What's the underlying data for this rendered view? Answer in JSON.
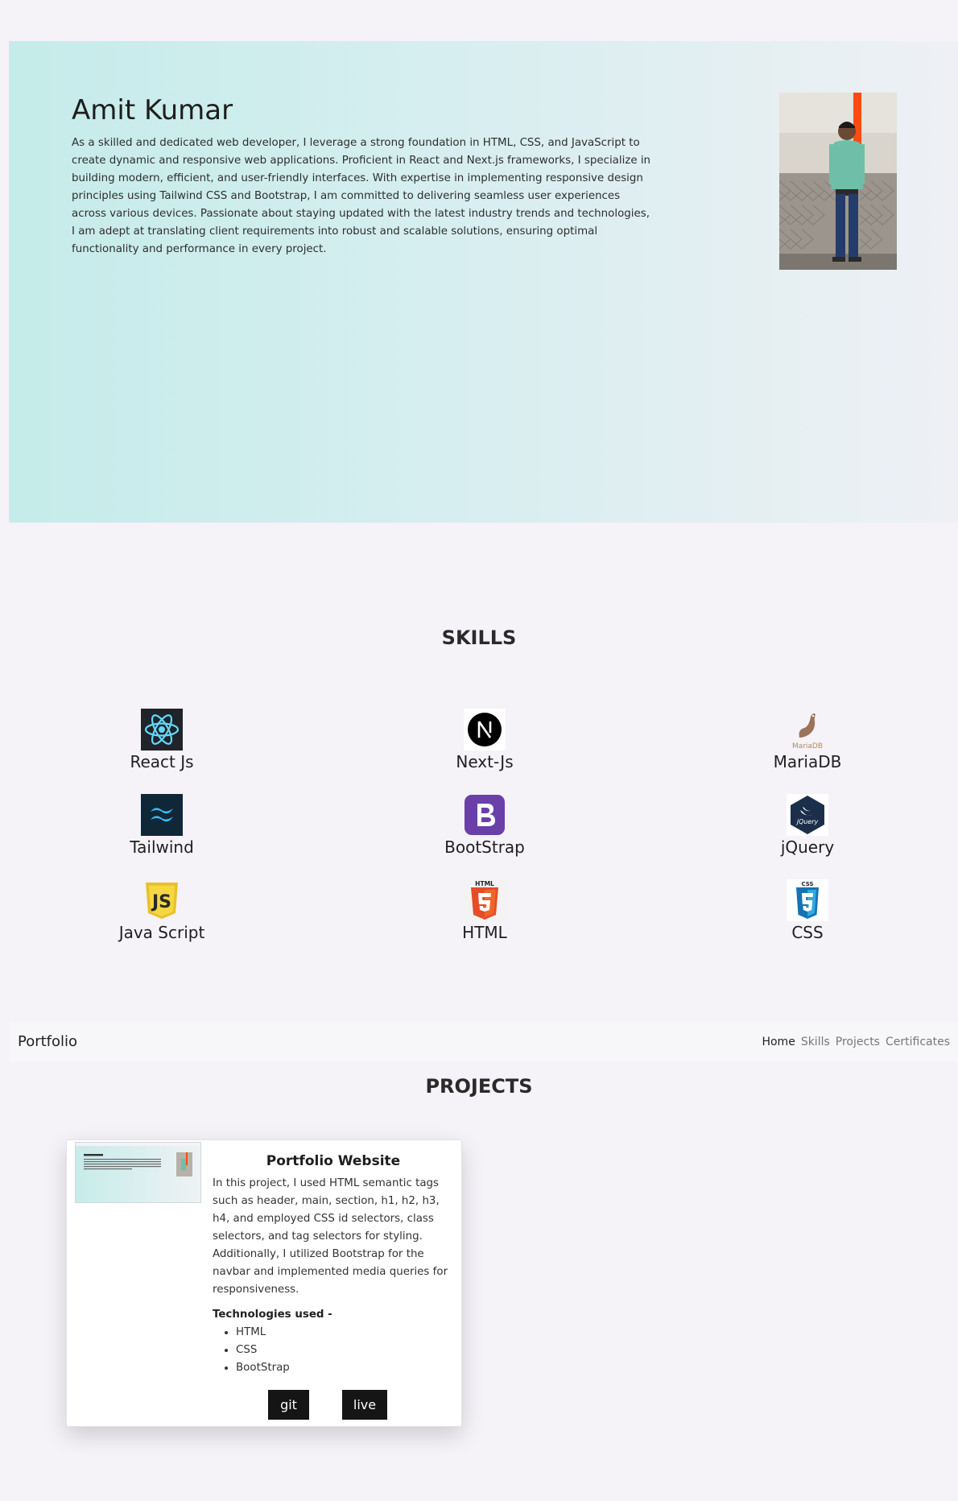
{
  "hero": {
    "name": "Amit Kumar",
    "bio": "As a skilled and dedicated web developer, I leverage a strong foundation in HTML, CSS, and JavaScript to create dynamic and responsive web applications. Proficient in React and Next.js frameworks, I specialize in building modern, efficient, and user-friendly interfaces. With expertise in implementing responsive design principles using Tailwind CSS and Bootstrap, I am committed to delivering seamless user experiences across various devices. Passionate about staying updated with the latest industry trends and technologies, I am adept at translating client requirements into robust and scalable solutions, ensuring optimal functionality and performance in every project."
  },
  "skills": {
    "title": "SKILLS",
    "items": [
      {
        "label": "React Js",
        "icon": "react-icon"
      },
      {
        "label": "Next-Js",
        "icon": "nextjs-icon"
      },
      {
        "label": "MariaDB",
        "icon": "mariadb-icon",
        "icon_text": "MariaDB"
      },
      {
        "label": "Tailwind",
        "icon": "tailwind-icon"
      },
      {
        "label": "BootStrap",
        "icon": "bootstrap-icon"
      },
      {
        "label": "jQuery",
        "icon": "jquery-icon",
        "icon_text": "jQuery"
      },
      {
        "label": "Java Script",
        "icon": "javascript-icon",
        "icon_text": "JS"
      },
      {
        "label": "HTML",
        "icon": "html5-icon",
        "icon_text": "HTML"
      },
      {
        "label": "CSS",
        "icon": "css3-icon",
        "icon_text": "CSS"
      }
    ]
  },
  "navbar": {
    "brand": "Portfolio",
    "links": [
      "Home",
      "Skills",
      "Projects",
      "Certificates"
    ]
  },
  "projects": {
    "title": "PROJECTS",
    "cards": [
      {
        "title": "Portfolio Website",
        "description": "In this project, I used HTML semantic tags such as header, main, section, h1, h2, h3, h4, and employed CSS id selectors, class selectors, and tag selectors for styling. Additionally, I utilized Bootstrap for the navbar and implemented media queries for responsiveness.",
        "tech_heading": "Technologies used -",
        "technologies": [
          "HTML",
          "CSS",
          "BootStrap"
        ],
        "git_label": "git",
        "live_label": "live"
      }
    ]
  }
}
